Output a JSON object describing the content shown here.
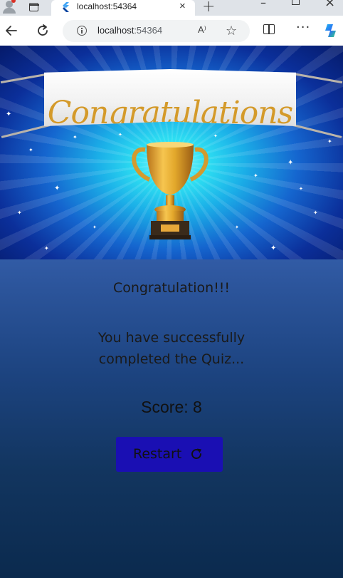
{
  "browser": {
    "tab_title": "localhost:54364",
    "tab_close": "×",
    "new_tab": "+",
    "url_host": "localhost",
    "url_port": ":54364",
    "read_aloud": "A⁾"
  },
  "hero": {
    "banner_text": "Congratulations"
  },
  "content": {
    "heading": "Congratulation!!!",
    "message": "You have successfully completed the Quiz...",
    "score_text": "Score: 8",
    "restart_label": "Restart"
  },
  "colors": {
    "page_top": "#4e7dd6",
    "page_bottom": "#0b2a4e",
    "button_bg": "#1a0fb3",
    "banner_text": "#d49a2a",
    "trophy_gold": "#e3a82c"
  }
}
